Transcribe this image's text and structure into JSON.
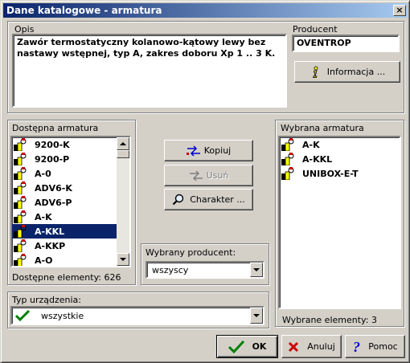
{
  "window": {
    "title": "Dane katalogowe - armatura",
    "close_glyph": "×"
  },
  "opis": {
    "label": "Opis",
    "text": "Zawór termostatyczny kolanowo-kątowy lewy bez nastawy wstępnej, typ A, zakres doboru Xp 1 .. 3 K."
  },
  "producent": {
    "label": "Producent",
    "value": "OVENTROP",
    "info_button": "Informacja ..."
  },
  "dostepna": {
    "label": "Dostępna armatura",
    "items": [
      "9200-K",
      "9200-P",
      "A-0",
      "ADV6-K",
      "ADV6-P",
      "A-K",
      "A-KKL",
      "A-KKP",
      "A-O"
    ],
    "selected_index": 6,
    "count_label": "Dostępne elementy: 626"
  },
  "actions": {
    "copy": "Kopiuj",
    "remove": "Usuń",
    "character": "Charakter ..."
  },
  "wybrany_producent": {
    "label": "Wybrany producent:",
    "value": "wszyscy"
  },
  "typ_urzadzenia": {
    "label": "Typ urządzenia:",
    "value": "wszystkie"
  },
  "wybrana": {
    "label": "Wybrana armatura",
    "items": [
      "A-K",
      "A-KKL",
      "UNIBOX-E-T"
    ],
    "count_label": "Wybrane elementy: 3"
  },
  "footer": {
    "ok": "OK",
    "cancel": "Anuluj",
    "help": "Pomoc"
  },
  "colors": {
    "title_start": "#0a246a",
    "title_end": "#a6caf0",
    "selection": "#0a246a",
    "valve_yellow": "#ffff00",
    "valve_red": "#cc0000"
  },
  "icons": {
    "valve": "valve-icon",
    "copy": "copy-arrows-icon",
    "remove": "remove-arrows-icon",
    "magnifier": "magnifier-icon",
    "info": "info-icon",
    "check": "check-icon",
    "cross": "cross-icon",
    "help": "help-icon"
  }
}
